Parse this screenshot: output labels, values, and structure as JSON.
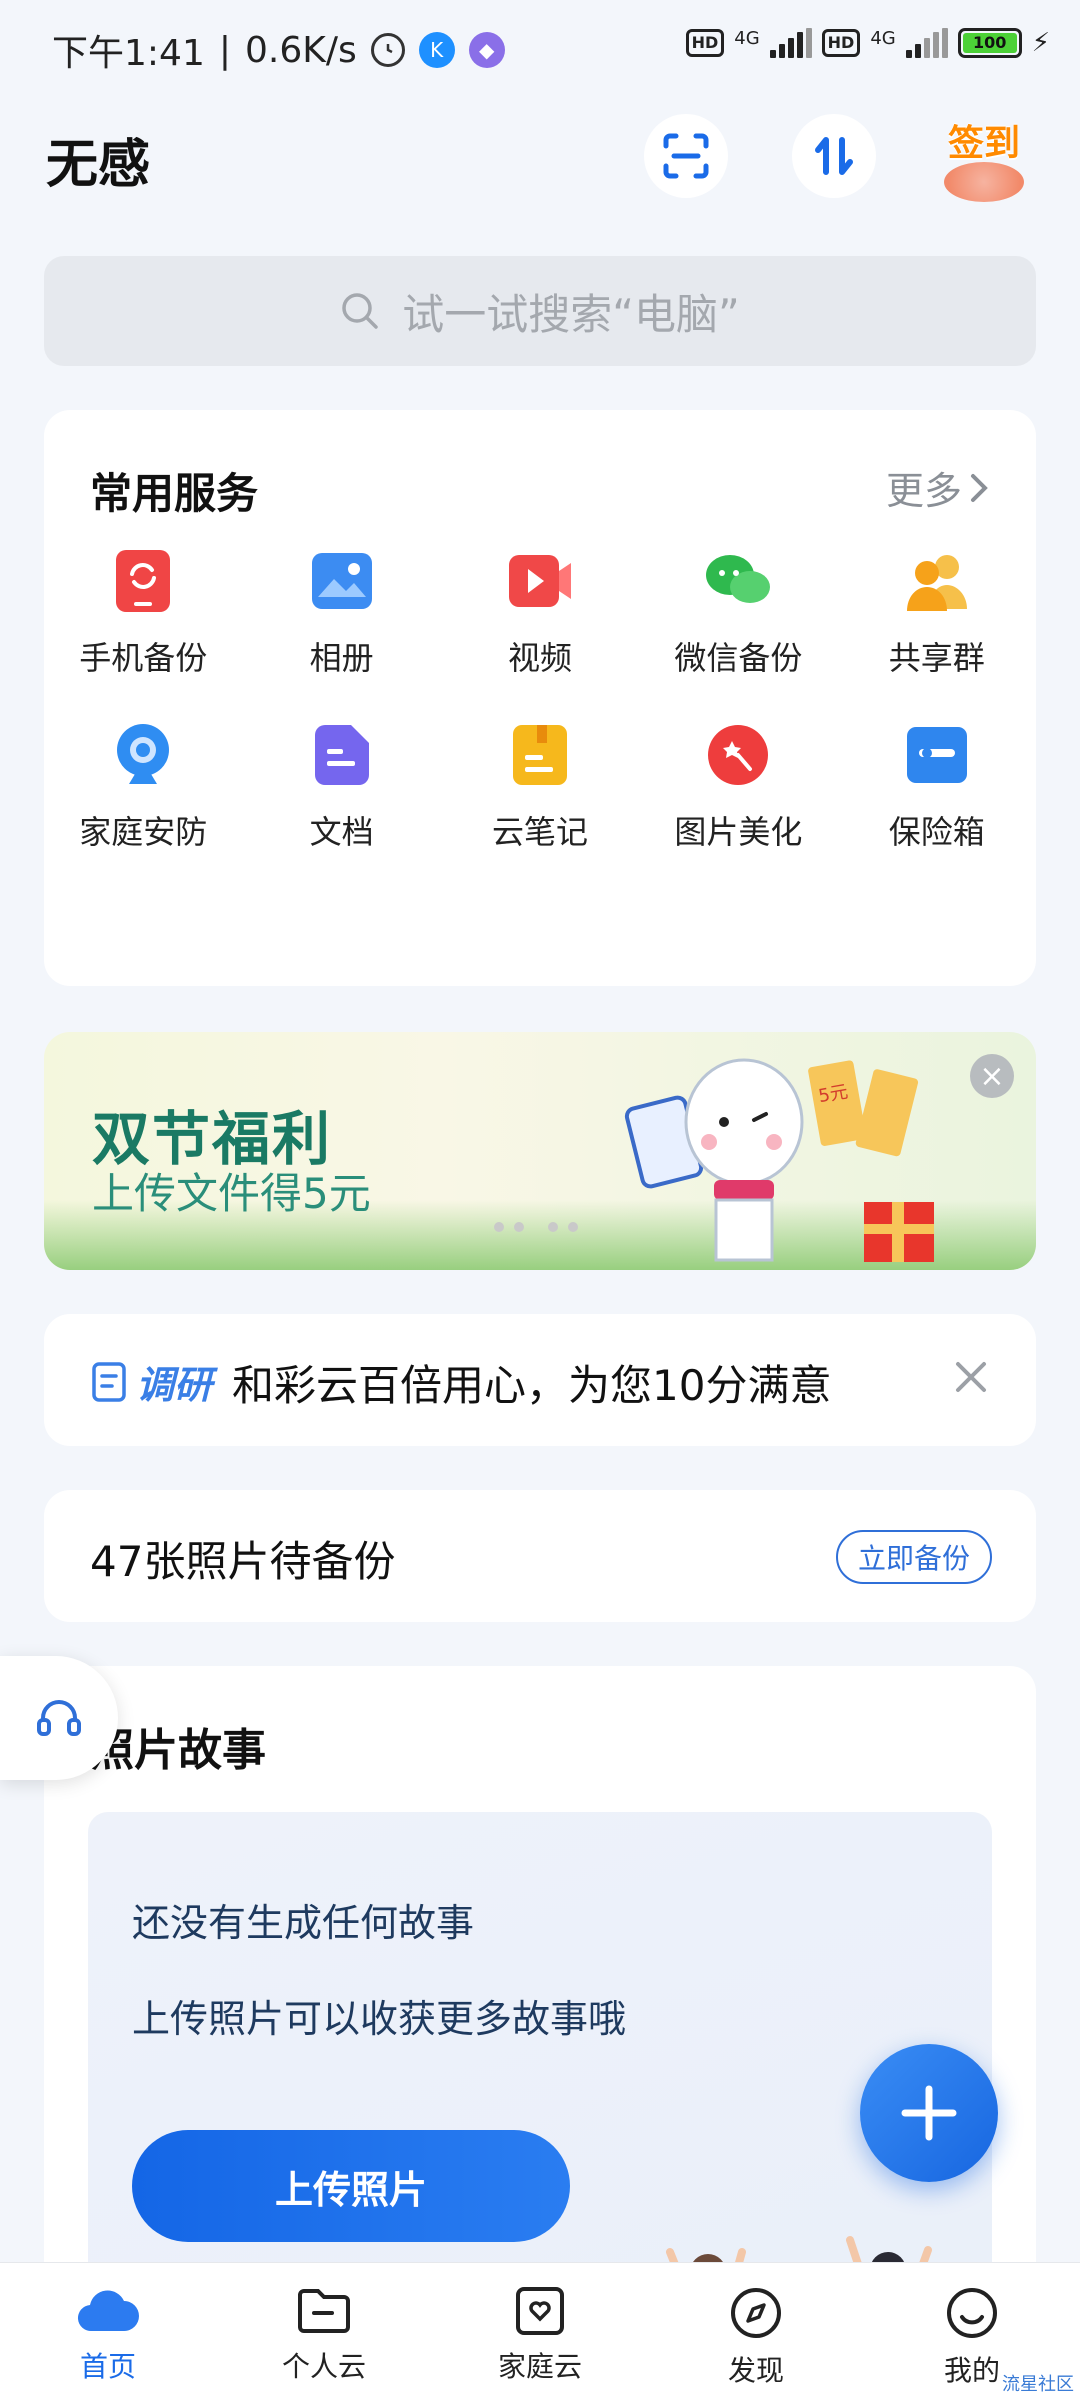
{
  "status_bar": {
    "time": "下午1:41",
    "speed": "0.6K/s",
    "network1": "4G",
    "network2": "4G",
    "hd": "HD",
    "battery": "100"
  },
  "header": {
    "title": "无感",
    "signin_label": "签到"
  },
  "search": {
    "placeholder": "试一试搜索“电脑”"
  },
  "services": {
    "title": "常用服务",
    "more": "更多",
    "items": [
      {
        "label": "手机备份",
        "icon": "phone-backup-icon",
        "color": "#f04545"
      },
      {
        "label": "相册",
        "icon": "album-icon",
        "color": "#3c8cf2"
      },
      {
        "label": "视频",
        "icon": "video-icon",
        "color": "#f04848"
      },
      {
        "label": "微信备份",
        "icon": "wechat-icon",
        "color": "#2fb94e"
      },
      {
        "label": "共享群",
        "icon": "share-group-icon",
        "color": "#f6a21a"
      },
      {
        "label": "家庭安防",
        "icon": "camera-icon",
        "color": "#2f8df2"
      },
      {
        "label": "文档",
        "icon": "document-icon",
        "color": "#7566ee"
      },
      {
        "label": "云笔记",
        "icon": "notes-icon",
        "color": "#f6b81c"
      },
      {
        "label": "图片美化",
        "icon": "beautify-icon",
        "color": "#ee3d3d"
      },
      {
        "label": "保险箱",
        "icon": "safe-icon",
        "color": "#2f86ee"
      }
    ]
  },
  "banner": {
    "title": "双节福利",
    "subtitle": "上传文件得5元",
    "coupon": "5元"
  },
  "survey": {
    "tag": "调研",
    "text": "和彩云百倍用心，为您10分满意"
  },
  "backup": {
    "text": "47张照片待备份",
    "button": "立即备份"
  },
  "story": {
    "title": "照片故事",
    "empty_line1": "还没有生成任何故事",
    "empty_line2": "上传照片可以收获更多故事哦",
    "upload_button": "上传照片"
  },
  "nav": {
    "items": [
      {
        "label": "首页",
        "icon": "cloud-icon",
        "active": true
      },
      {
        "label": "个人云",
        "icon": "folder-icon",
        "active": false
      },
      {
        "label": "家庭云",
        "icon": "family-cloud-icon",
        "active": false
      },
      {
        "label": "发现",
        "icon": "compass-icon",
        "active": false
      },
      {
        "label": "我的",
        "icon": "smile-icon",
        "active": false
      }
    ]
  },
  "watermark": "流星社区",
  "colors": {
    "accent": "#1a6be8",
    "background": "#f3f6fb"
  }
}
